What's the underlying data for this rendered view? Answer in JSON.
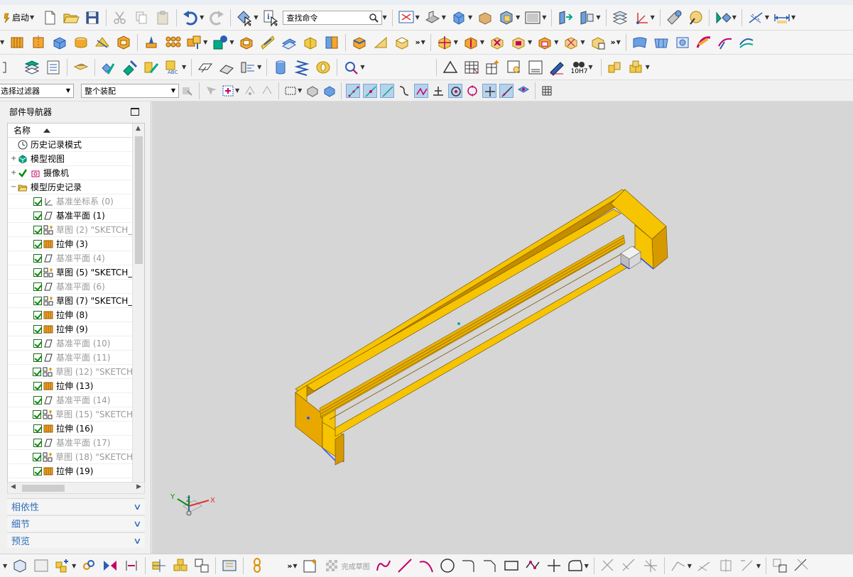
{
  "toolbar": {
    "start_label": "启动",
    "search_placeholder": "查找命令",
    "selection_filter": "选择过滤器",
    "assembly_scope": "整个装配",
    "tolerance_label": "10H7"
  },
  "navigator": {
    "title": "部件导航器",
    "column_name": "名称",
    "top_nodes": [
      {
        "label": "历史记录模式"
      },
      {
        "label": "模型视图"
      },
      {
        "label": "摄像机"
      },
      {
        "label": "模型历史记录"
      }
    ],
    "features": [
      {
        "label": "基准坐标系 (0)",
        "kind": "csys",
        "dim": true
      },
      {
        "label": "基准平面 (1)",
        "kind": "plane",
        "dim": false
      },
      {
        "label": "草图 (2) \"SKETCH_",
        "kind": "sketch",
        "dim": true
      },
      {
        "label": "拉伸 (3)",
        "kind": "extrude",
        "dim": false
      },
      {
        "label": "基准平面 (4)",
        "kind": "plane",
        "dim": true
      },
      {
        "label": "草图 (5) \"SKETCH_",
        "kind": "sketch",
        "dim": false
      },
      {
        "label": "基准平面 (6)",
        "kind": "plane",
        "dim": true
      },
      {
        "label": "草图 (7) \"SKETCH_",
        "kind": "sketch",
        "dim": false
      },
      {
        "label": "拉伸 (8)",
        "kind": "extrude",
        "dim": false
      },
      {
        "label": "拉伸 (9)",
        "kind": "extrude",
        "dim": false
      },
      {
        "label": "基准平面 (10)",
        "kind": "plane",
        "dim": true
      },
      {
        "label": "基准平面 (11)",
        "kind": "plane",
        "dim": true
      },
      {
        "label": "草图 (12) \"SKETCH",
        "kind": "sketch",
        "dim": true
      },
      {
        "label": "拉伸 (13)",
        "kind": "extrude",
        "dim": false
      },
      {
        "label": "基准平面 (14)",
        "kind": "plane",
        "dim": true
      },
      {
        "label": "草图 (15) \"SKETCH",
        "kind": "sketch",
        "dim": true
      },
      {
        "label": "拉伸 (16)",
        "kind": "extrude",
        "dim": false
      },
      {
        "label": "基准平面 (17)",
        "kind": "plane",
        "dim": true
      },
      {
        "label": "草图 (18) \"SKETCH",
        "kind": "sketch",
        "dim": true
      },
      {
        "label": "拉伸 (19)",
        "kind": "extrude",
        "dim": false
      }
    ],
    "panels": [
      {
        "label": "相依性"
      },
      {
        "label": "细节"
      },
      {
        "label": "预览"
      }
    ]
  },
  "sketch_bar": {
    "finish_sketch": "完成草图"
  },
  "triad": {
    "x_label": "X",
    "y_label": "Y",
    "z_label": "Z"
  },
  "colors": {
    "model_yellow": "#f6c400",
    "model_dark": "#c48c00",
    "viewport_bg": "#d6d6d6",
    "panel_blue": "#2f6db8"
  }
}
